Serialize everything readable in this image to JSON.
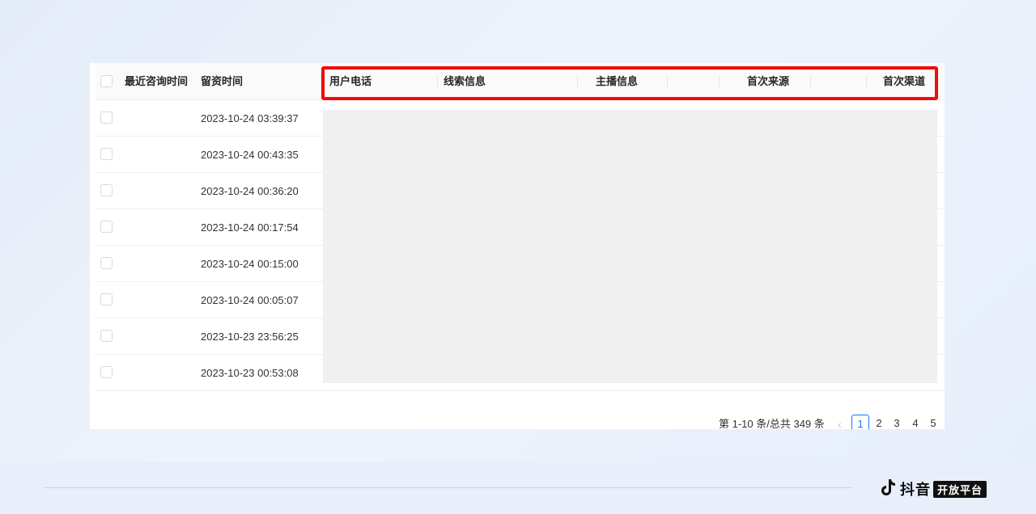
{
  "table": {
    "columns": [
      "最近咨询时间",
      "留资时间",
      "用户电话",
      "线索信息",
      "主播信息",
      "首次来源",
      "首次渠道"
    ],
    "rows": [
      {
        "time": "2023-10-24 03:39:37"
      },
      {
        "time": "2023-10-24 00:43:35"
      },
      {
        "time": "2023-10-24 00:36:20"
      },
      {
        "time": "2023-10-24 00:17:54"
      },
      {
        "time": "2023-10-24 00:15:00"
      },
      {
        "time": "2023-10-24 00:05:07"
      },
      {
        "time": "2023-10-23 23:56:25"
      },
      {
        "time": "2023-10-23 00:53:08"
      }
    ]
  },
  "pagination": {
    "summary": "第 1-10 条/总共 349 条",
    "prev_icon": "chevron-left-icon",
    "prev_glyph": "‹",
    "pages": [
      "1",
      "2",
      "3",
      "4",
      "5"
    ],
    "current": "1"
  },
  "brand": {
    "name": "抖音",
    "badge": "开放平台",
    "icon": "douyin-note-icon"
  },
  "colors": {
    "highlight": "#f20a0a",
    "accent": "#1677ff",
    "mask": "#f0f0f0"
  }
}
